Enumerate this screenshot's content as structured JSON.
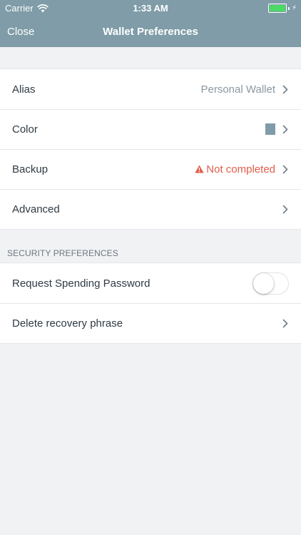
{
  "status_bar": {
    "carrier": "Carrier",
    "time": "1:33 AM",
    "battery_color": "#4cd964"
  },
  "nav": {
    "close_label": "Close",
    "title": "Wallet Preferences"
  },
  "colors": {
    "header_bg": "#7f9ca8",
    "background": "#f1f2f4",
    "warning": "#e25d4a",
    "wallet_color": "#7f9ca8"
  },
  "main_group": {
    "alias": {
      "label": "Alias",
      "value": "Personal Wallet"
    },
    "color": {
      "label": "Color"
    },
    "backup": {
      "label": "Backup",
      "value": "Not completed",
      "icon": "warning-icon"
    },
    "advanced": {
      "label": "Advanced"
    }
  },
  "security": {
    "section_title": "SECURITY PREFERENCES",
    "spending_password": {
      "label": "Request Spending Password",
      "enabled": false
    },
    "delete_phrase": {
      "label": "Delete recovery phrase"
    }
  }
}
